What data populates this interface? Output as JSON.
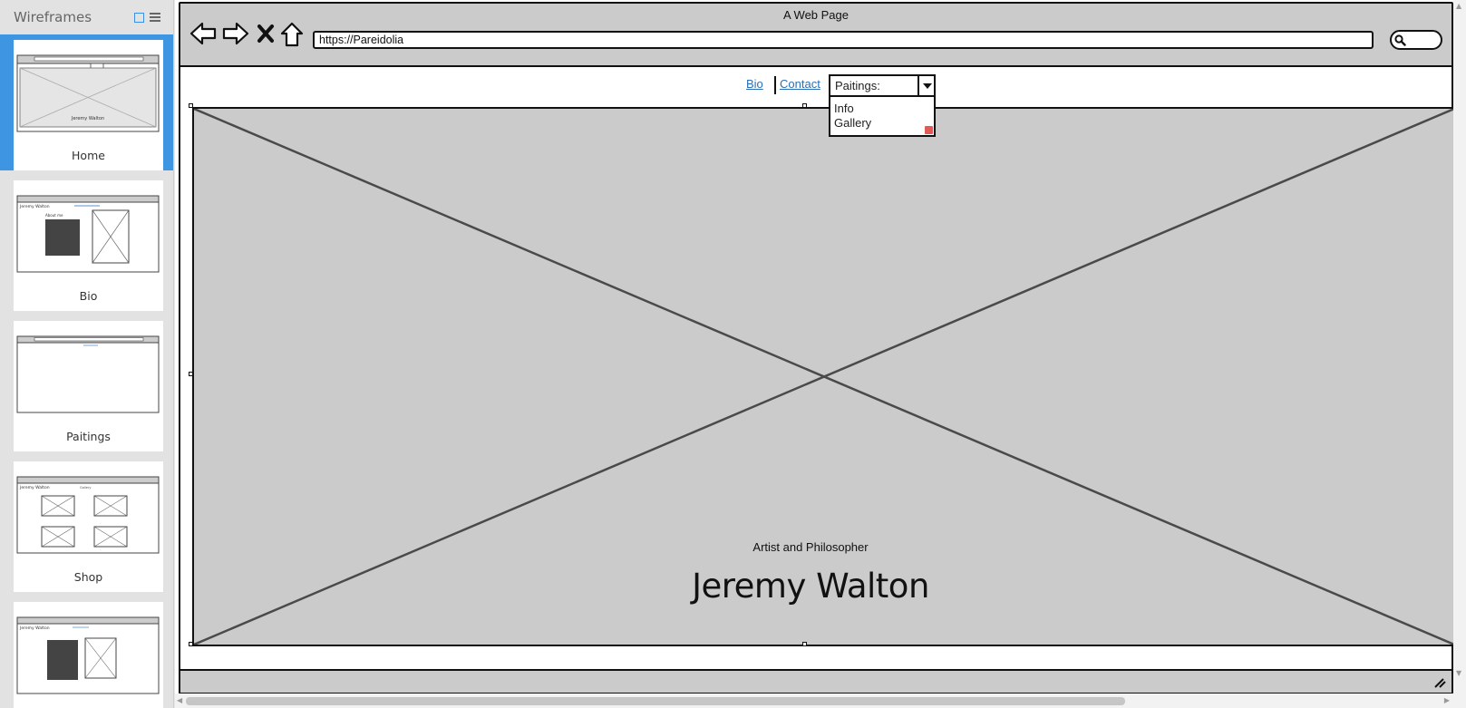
{
  "panel": {
    "title": "Wireframes",
    "pages": [
      {
        "label": "Home",
        "selected": true
      },
      {
        "label": "Bio",
        "selected": false
      },
      {
        "label": "Paitings",
        "selected": false
      },
      {
        "label": "Shop",
        "selected": false
      },
      {
        "label": "",
        "selected": false
      }
    ]
  },
  "browser": {
    "window_title": "A Web Page",
    "url": "https://Pareidolia"
  },
  "menu": {
    "bio": "Bio",
    "contact": "Contact",
    "paintings_select": "Paitings:",
    "dropdown_options": [
      "Info",
      "Gallery"
    ]
  },
  "hero": {
    "tagline": "Artist and Philosopher",
    "name": "Jeremy Walton"
  },
  "colors": {
    "selection": "#3e96e2",
    "placeholder_fill": "#cbcbcb",
    "link": "#2c6fb5"
  }
}
